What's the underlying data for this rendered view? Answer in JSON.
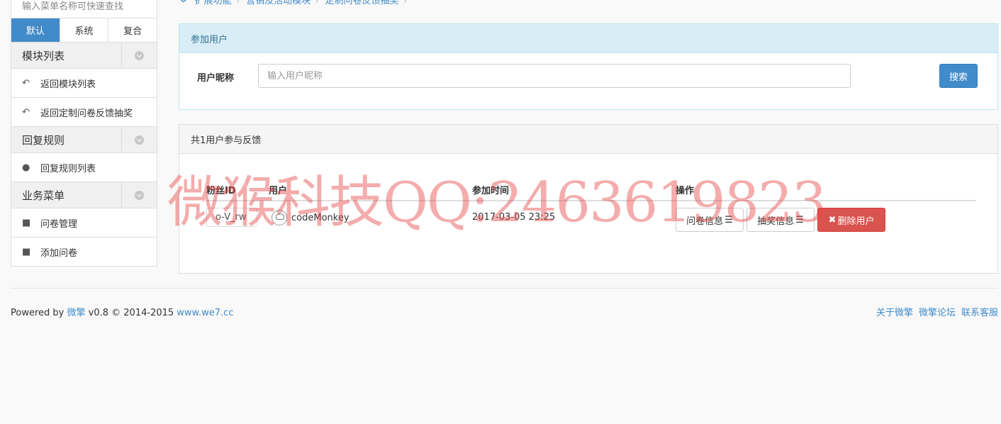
{
  "sidebar": {
    "search_text": "输入菜单名称可快速查找",
    "tabs": [
      "默认",
      "系统",
      "复合"
    ],
    "active_tab": "默认",
    "groups": [
      {
        "title": "模块列表",
        "items": [
          {
            "label": "返回模块列表",
            "icon": "reply-icon"
          },
          {
            "label": "返回定制问卷反馈抽奖",
            "icon": "reply-icon"
          }
        ]
      },
      {
        "title": "回复规则",
        "items": [
          {
            "label": "回复规则列表",
            "icon": "comments-icon"
          }
        ]
      },
      {
        "title": "业务菜单",
        "items": [
          {
            "label": "问卷管理",
            "icon": "puzzle-icon"
          },
          {
            "label": "添加问卷",
            "icon": "puzzle-icon"
          }
        ]
      }
    ]
  },
  "breadcrumb": {
    "icon": "gear-icon",
    "items": [
      "扩展功能",
      "营销及活动模块",
      "定制问卷反馈抽奖"
    ]
  },
  "search_panel": {
    "heading": "参加用户",
    "label": "用户昵称",
    "placeholder": "输入用户昵称",
    "button": "搜索"
  },
  "list_panel": {
    "heading": "共1用户参与反馈",
    "columns": [
      "粉丝ID",
      "用户",
      "参加时间",
      "操作"
    ],
    "rows": [
      {
        "fans_id": "o-V_rw",
        "user": "codeMonkey",
        "time": "2017-03-05 23:25",
        "actions": [
          "问卷信息",
          "抽奖信息",
          "删除用户"
        ]
      }
    ]
  },
  "footer": {
    "powered_by": "Powered by",
    "brand": "微擎",
    "version": "v0.8 © 2014-2015",
    "site": "www.we7.cc",
    "links": [
      "关于微擎",
      "微擎论坛",
      "联系客服"
    ]
  },
  "watermark": "微猴科技QQ:2463619823",
  "colors": {
    "primary": "#428bca",
    "danger": "#d9534f",
    "info_bg": "#d9edf7",
    "watermark": "#e64646"
  }
}
